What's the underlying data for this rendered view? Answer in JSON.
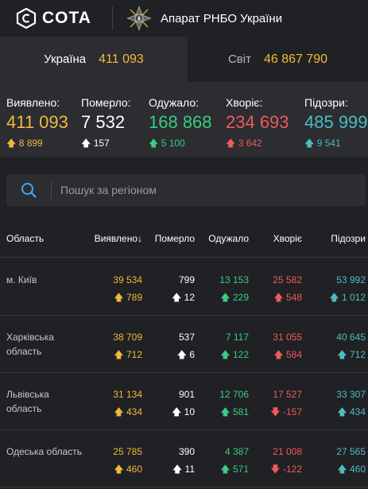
{
  "header": {
    "logo_text": "COTA",
    "org_name": "Апарат РНБО України"
  },
  "tabs": [
    {
      "label": "Україна",
      "value": "411 093"
    },
    {
      "label": "Світ",
      "value": "46 867 790"
    }
  ],
  "stats": [
    {
      "label": "Виявлено:",
      "value": "411 093",
      "delta": "8 899",
      "color": "#f2b93b"
    },
    {
      "label": "Померло:",
      "value": "7 532",
      "delta": "157",
      "color": "#ffffff"
    },
    {
      "label": "Одужало:",
      "value": "168 868",
      "delta": "5 100",
      "color": "#3ccb7f"
    },
    {
      "label": "Хворіє:",
      "value": "234 693",
      "delta": "3 642",
      "color": "#f05a5a"
    },
    {
      "label": "Підозри:",
      "value": "485 999",
      "delta": "9 541",
      "color": "#4fbcbf"
    }
  ],
  "search": {
    "placeholder": "Пошук за регіоном"
  },
  "table": {
    "columns": [
      "Область",
      "Виявлено",
      "Померло",
      "Одужало",
      "Хворіє",
      "Підозри"
    ],
    "sort_arrow": "↓",
    "rows": [
      {
        "region": "м. Київ",
        "confirmed": "39 534",
        "confirmed_delta": "789",
        "deaths": "799",
        "deaths_delta": "12",
        "recovered": "13 153",
        "recovered_delta": "229",
        "sick": "25 582",
        "sick_delta": "548",
        "suspected": "53 992",
        "suspected_delta": "1 012"
      },
      {
        "region": "Харківська область",
        "confirmed": "38 709",
        "confirmed_delta": "712",
        "deaths": "537",
        "deaths_delta": "6",
        "recovered": "7 117",
        "recovered_delta": "122",
        "sick": "31 055",
        "sick_delta": "584",
        "suspected": "40 645",
        "suspected_delta": "712"
      },
      {
        "region": "Львівська область",
        "confirmed": "31 134",
        "confirmed_delta": "434",
        "deaths": "901",
        "deaths_delta": "10",
        "recovered": "12 706",
        "recovered_delta": "581",
        "sick": "17 527",
        "sick_delta": "-157",
        "suspected": "33 307",
        "suspected_delta": "434"
      },
      {
        "region": "Одеська область",
        "confirmed": "25 785",
        "confirmed_delta": "460",
        "deaths": "390",
        "deaths_delta": "11",
        "recovered": "4 387",
        "recovered_delta": "571",
        "sick": "21 008",
        "sick_delta": "-122",
        "suspected": "27 565",
        "suspected_delta": "460"
      }
    ]
  }
}
